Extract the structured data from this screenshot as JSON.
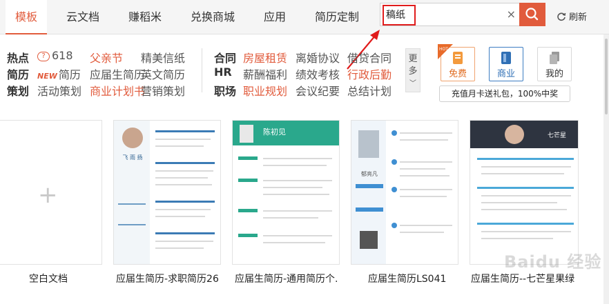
{
  "nav": {
    "tabs": [
      {
        "label": "模板",
        "active": true
      },
      {
        "label": "云文档"
      },
      {
        "label": "赚稻米"
      },
      {
        "label": "兑换商城"
      },
      {
        "label": "应用"
      },
      {
        "label": "简历定制"
      }
    ],
    "search_value": "稿纸",
    "search_clear": "×",
    "refresh_label": "刷新"
  },
  "categories": {
    "rows": [
      {
        "head": "热点",
        "items": [
          "618",
          "父亲节",
          "精美信纸"
        ]
      },
      {
        "head": "简历",
        "items": [
          "简历",
          "应届生简历",
          "英文简历"
        ],
        "new_tag": "NEW"
      },
      {
        "head": "策划",
        "items": [
          "活动策划",
          "商业计划书",
          "营销策划"
        ]
      }
    ],
    "rows2": [
      {
        "head": "合同",
        "items": [
          "房屋租赁",
          "离婚协议",
          "借贷合同"
        ]
      },
      {
        "head": "HR",
        "items": [
          "薪酬福利",
          "绩效考核",
          "行政后勤"
        ]
      },
      {
        "head": "职场",
        "items": [
          "职业规划",
          "会议纪要",
          "总结计划"
        ]
      }
    ],
    "more_label": "更多"
  },
  "right_panel": {
    "hot_tag": "HOT",
    "buttons": [
      {
        "label": "免费",
        "icon": "free-doc-icon"
      },
      {
        "label": "商业",
        "icon": "business-doc-icon"
      },
      {
        "label": "我的",
        "icon": "my-docs-icon"
      }
    ],
    "promo": "充值月卡送礼包，100%中奖"
  },
  "templates": [
    {
      "caption": "空白文档"
    },
    {
      "caption": "应届生简历-求职简历26",
      "name_on_card": "飞 雨 扬"
    },
    {
      "caption": "应届生简历-通用简历个.",
      "name_on_card": "陈初见"
    },
    {
      "caption": "应届生简历LS041",
      "name_on_card": "郁亮凡"
    },
    {
      "caption": "应届生简历--七芒星果绿",
      "name_on_card": "七芒星"
    }
  ],
  "watermark": "Baidu 经验",
  "colors": {
    "accent": "#e15b3c",
    "highlight": "#e01b1b",
    "biz": "#2f6fb5",
    "teal": "#2aa88c"
  }
}
